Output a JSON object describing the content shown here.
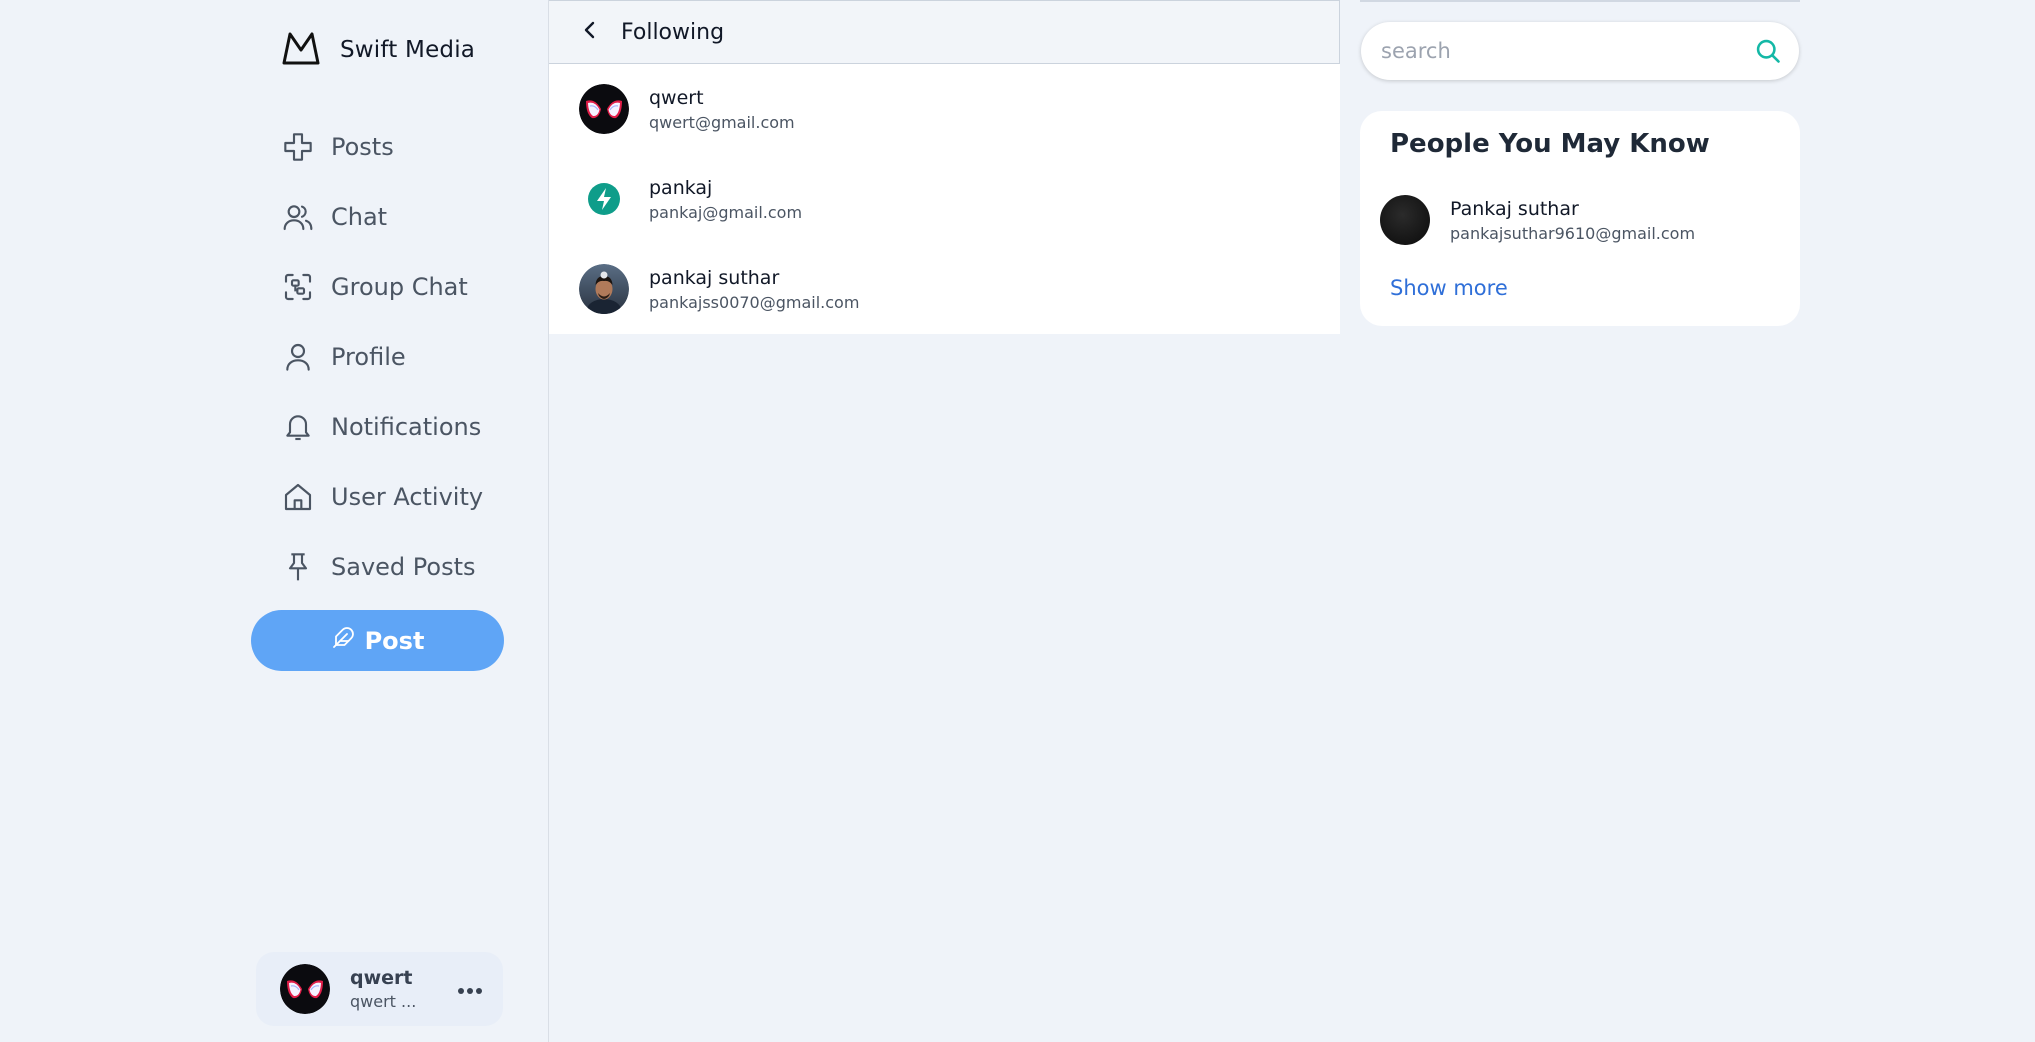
{
  "brand": {
    "name": "Swift Media",
    "logo_icon": "mountain-logo-icon"
  },
  "sidebar": {
    "items": [
      {
        "label": "Posts",
        "icon": "plus-icon"
      },
      {
        "label": "Chat",
        "icon": "users-icon"
      },
      {
        "label": "Group Chat",
        "icon": "group-scan-icon"
      },
      {
        "label": "Profile",
        "icon": "user-icon"
      },
      {
        "label": "Notifications",
        "icon": "bell-icon"
      },
      {
        "label": "User Activity",
        "icon": "home-icon"
      },
      {
        "label": "Saved Posts",
        "icon": "pin-icon"
      }
    ],
    "post_button": {
      "label": "Post",
      "icon": "feather-icon",
      "color": "#5fa5f6"
    },
    "current_user": {
      "name": "qwert",
      "handle": "qwert ..."
    }
  },
  "main": {
    "title": "Following",
    "following": [
      {
        "name": "qwert",
        "email": "qwert@gmail.com",
        "avatar": "spider-mask-avatar"
      },
      {
        "name": "pankaj",
        "email": "pankaj@gmail.com",
        "avatar": "bolt-avatar"
      },
      {
        "name": "pankaj suthar",
        "email": "pankajss0070@gmail.com",
        "avatar": "photo-avatar"
      }
    ]
  },
  "right": {
    "search": {
      "placeholder": "search",
      "value": ""
    },
    "suggestions": {
      "title": "People You May Know",
      "people": [
        {
          "name": "Pankaj suthar",
          "email": "pankajsuthar9610@gmail.com"
        }
      ],
      "show_more": "Show more"
    }
  },
  "colors": {
    "background": "#eff3f9",
    "accent": "#5fa5f6",
    "link": "#2f6fd8",
    "search_icon": "#14b8a6",
    "bolt_avatar": "#0f9d8a"
  }
}
